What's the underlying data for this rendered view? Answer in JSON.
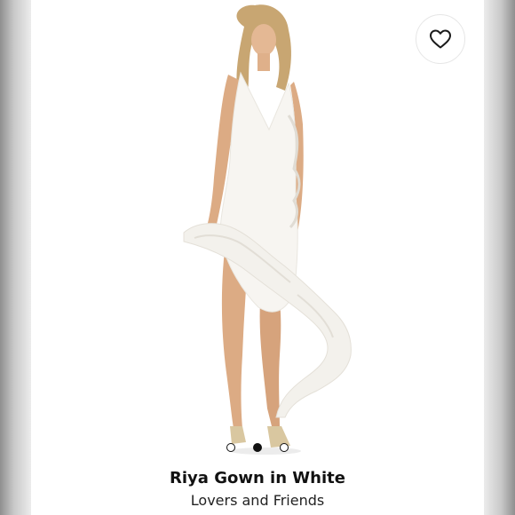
{
  "listing": {
    "title": "Riya Gown in White",
    "brand": "Lovers and Friends"
  },
  "carousel": {
    "total_images": 3,
    "active_index": 1
  },
  "icons": {
    "favorite": "heart-outline-icon"
  }
}
